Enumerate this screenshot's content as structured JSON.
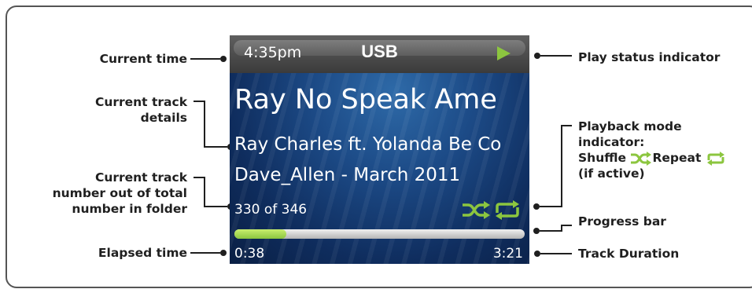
{
  "screen": {
    "time": "4:35pm",
    "source": "USB",
    "track_title": "Ray No Speak Ame",
    "artist": "Ray Charles ft. Yolanda Be Co",
    "album": "Dave_Allen - March 2011",
    "track_count": "330 of 346",
    "elapsed": "0:38",
    "duration": "3:21",
    "progress_fraction": 0.18,
    "accent_color": "#8cc63f",
    "play_status_icon": "play-icon",
    "mode_icons": [
      "shuffle-icon",
      "repeat-icon"
    ]
  },
  "callouts": {
    "current_time": "Current time",
    "track_details_line1": "Current track",
    "track_details_line2": "details",
    "track_number_line1": "Current track",
    "track_number_line2": "number out of total",
    "track_number_line3": "number in folder",
    "elapsed_time": "Elapsed time",
    "play_status": "Play status indicator",
    "playback_mode_line1": "Playback mode",
    "playback_mode_line2": "indicator:",
    "shuffle": "Shuffle",
    "repeat": "Repeat",
    "if_active": "(if active)",
    "progress_bar": "Progress bar",
    "track_duration": "Track Duration"
  }
}
